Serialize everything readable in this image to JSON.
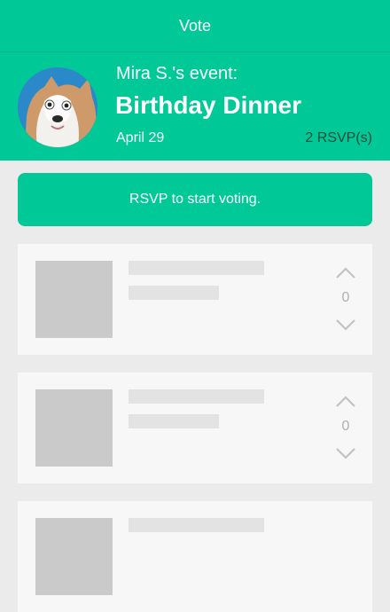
{
  "topbar": {
    "title": "Vote"
  },
  "event": {
    "host_line": "Mira S.'s event:",
    "title": "Birthday Dinner",
    "date": "April 29",
    "rsvp_count": "2 RSVP(s)"
  },
  "rsvp_button": {
    "label": "RSVP to start voting."
  },
  "items": [
    {
      "votes": "0"
    },
    {
      "votes": "0"
    },
    {
      "votes": ""
    }
  ],
  "colors": {
    "accent": "#00c896",
    "placeholder": "#cacaca",
    "card_bg": "#f7f7f7",
    "page_bg": "#ebebeb"
  }
}
